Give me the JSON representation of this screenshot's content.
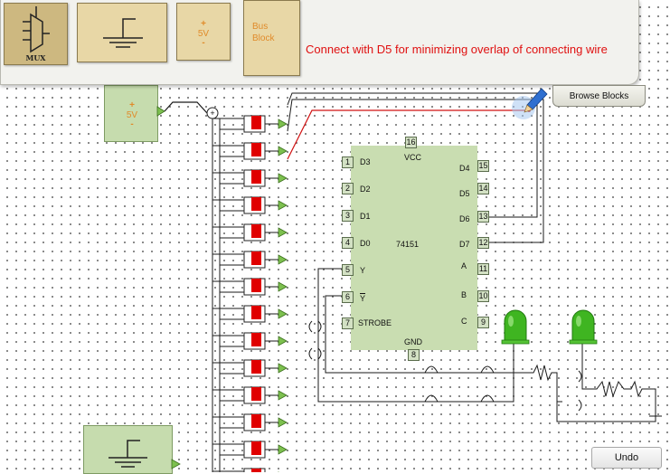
{
  "palette": {
    "mux_label": "MUX",
    "vcc_plus": "+",
    "vcc_label": "5V",
    "vcc_minus": "-",
    "bus_block_label": "Bus\nBlock"
  },
  "status_message": "Connect with D5 for minimizing overlap of connecting wire",
  "browse_blocks_label": "Browse Blocks",
  "undo_label": "Undo",
  "source": {
    "plus": "+",
    "label": "5V",
    "minus": "-"
  },
  "chip": {
    "name": "74151",
    "vcc_label": "VCC",
    "gnd_label": "GND",
    "left_pins": [
      {
        "num": "1",
        "label": "D3"
      },
      {
        "num": "2",
        "label": "D2"
      },
      {
        "num": "3",
        "label": "D1"
      },
      {
        "num": "4",
        "label": "D0"
      },
      {
        "num": "5",
        "label": "Y"
      },
      {
        "num": "6",
        "label": "Y"
      },
      {
        "num": "7",
        "label": "STROBE"
      }
    ],
    "right_pins": [
      {
        "num": "15",
        "label": "D4"
      },
      {
        "num": "14",
        "label": "D5"
      },
      {
        "num": "13",
        "label": "D6"
      },
      {
        "num": "12",
        "label": "D7"
      },
      {
        "num": "11",
        "label": "A"
      },
      {
        "num": "10",
        "label": "B"
      },
      {
        "num": "9",
        "label": "C"
      }
    ],
    "top_pin": {
      "num": "16"
    },
    "bottom_pin": {
      "num": "8"
    }
  },
  "colors": {
    "wire": "#1a1a1a",
    "active_wire": "#d01010",
    "switch_red": "#e00000",
    "led_green": "#3fb521",
    "block_green": "#c6dcae"
  }
}
